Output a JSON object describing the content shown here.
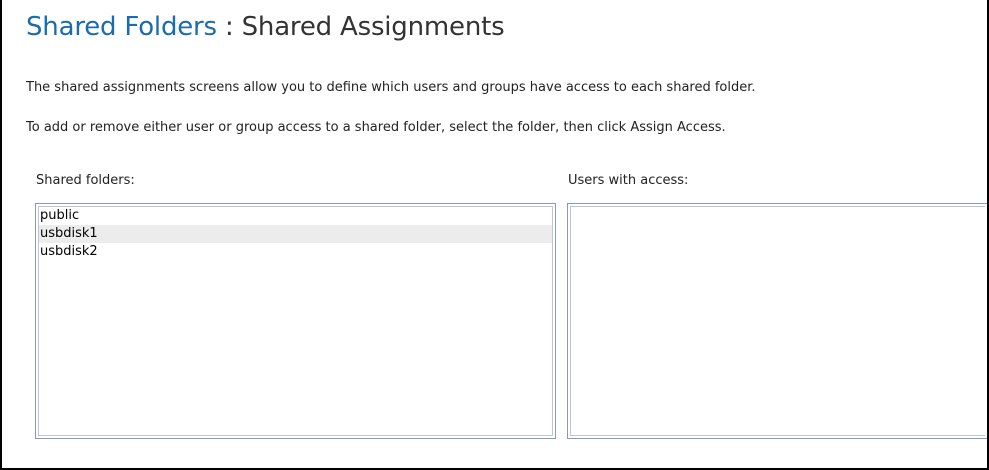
{
  "header": {
    "breadcrumb_link": "Shared Folders",
    "separator": " : ",
    "title": "Shared Assignments"
  },
  "descriptions": [
    "The shared assignments screens allow you to define which users and groups have access to each shared folder.",
    "To add or remove either user or group access to a shared folder, select the folder, then click Assign Access."
  ],
  "shared_folders": {
    "label": "Shared folders:",
    "items": [
      "public",
      "usbdisk1",
      "usbdisk2"
    ],
    "selected": "usbdisk1"
  },
  "users_with_access": {
    "label": "Users with access:",
    "items": []
  },
  "colors": {
    "link": "#1b6bb0",
    "title": "#333333",
    "selected_row": "#ececec",
    "list_border": "#8a9ab0"
  }
}
